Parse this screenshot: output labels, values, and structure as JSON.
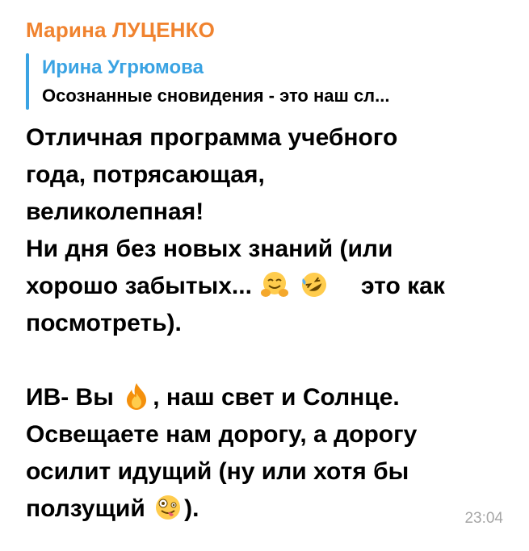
{
  "message": {
    "sender_name": "Марина ЛУЦЕНКО",
    "reply": {
      "author": "Ирина Угрюмова",
      "text": "Осознанные сновидения - это наш сл..."
    },
    "lines": [
      "Отличная программа учебного",
      "года, потрясающая,",
      "великолепная!",
      "Ни дня без новых знаний (или",
      "хорошо забытых...",
      "это как",
      "посмотреть).",
      "ИВ- Вы",
      ", наш свет и Солнце.",
      "Освещаете нам дорогу, а дорогу",
      "осилит идущий (ну или хотя бы",
      "ползущий",
      ")."
    ],
    "emojis": [
      "hugging-face-emoji",
      "rofl-emoji",
      "fire-emoji",
      "zany-face-emoji"
    ],
    "time": "23:04"
  },
  "colors": {
    "sender": "#f0832f",
    "reply_accent": "#3aa3e3",
    "time": "#a6a6a6"
  }
}
